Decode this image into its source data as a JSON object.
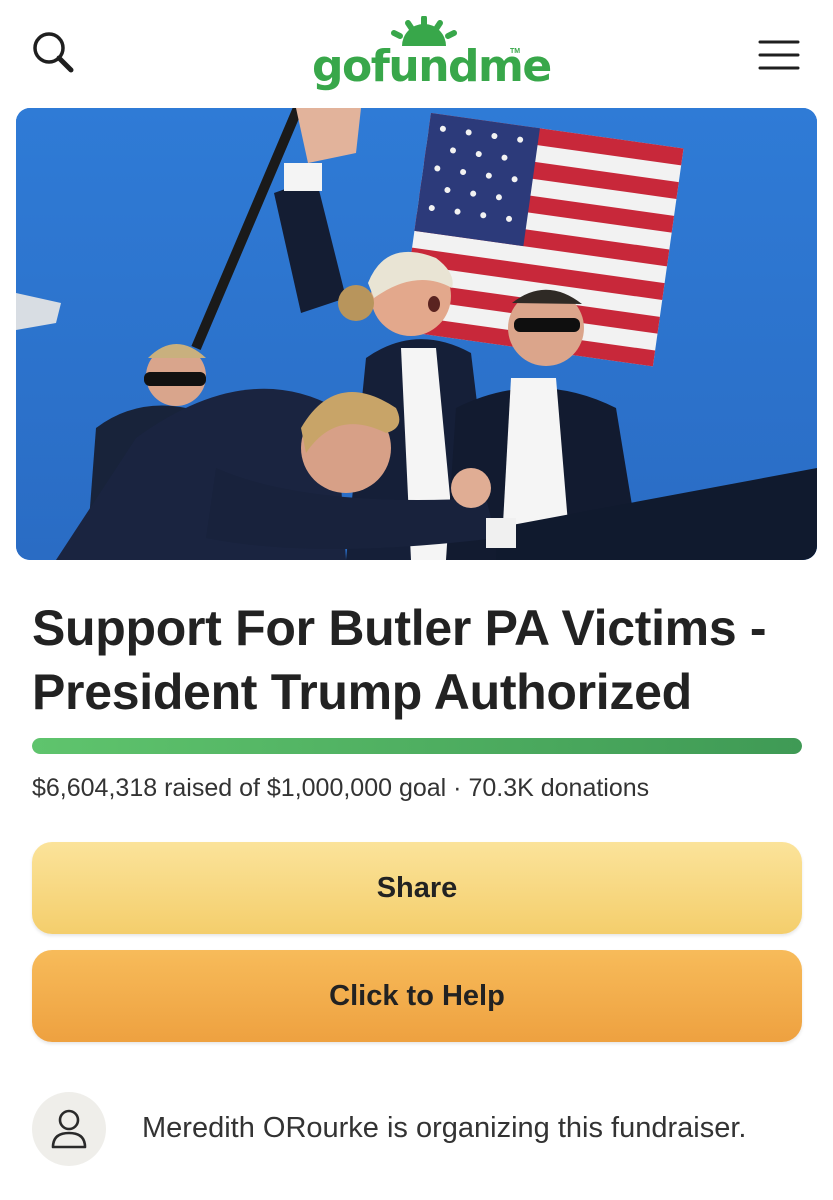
{
  "header": {
    "logo_text": "gofundme",
    "logo_tm": "TM",
    "brand_color": "#38a74a",
    "search_icon": "search-icon",
    "menu_icon": "hamburger-menu-icon"
  },
  "hero": {
    "image": "campaign-photo"
  },
  "campaign": {
    "title": "Support For Butler PA Victims - President Trump Authorized",
    "stats": "$6,604,318 raised of $1,000,000 goal · 70.3K donations",
    "progress_fraction": 1.0
  },
  "buttons": {
    "share_label": "Share",
    "help_label": "Click to Help"
  },
  "organizer": {
    "avatar_icon": "person-icon",
    "text": "Meredith ORourke is organizing this fundraiser."
  }
}
